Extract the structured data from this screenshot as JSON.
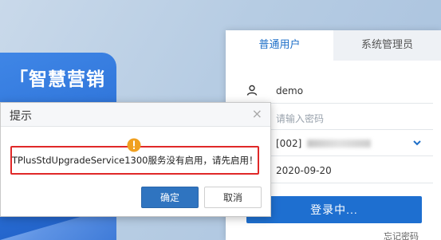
{
  "promo": {
    "title": "「智慧营销"
  },
  "login": {
    "tabs": [
      {
        "label": "普通用户",
        "active": true
      },
      {
        "label": "系统管理员",
        "active": false
      }
    ],
    "username": "demo",
    "password_placeholder": "请输入密码",
    "account_prefix": "[002]",
    "date": "2020-09-20",
    "login_button": "登录中...",
    "forgot_password": "忘记密码"
  },
  "modal": {
    "title": "提示",
    "close_symbol": "×",
    "message": "TPlusStdUpgradeService1300服务没有启用，请先启用！",
    "ok_label": "确定",
    "cancel_label": "取消"
  },
  "colors": {
    "accent": "#1e6fd0",
    "error_border": "#e02828",
    "warning": "#f0a020"
  }
}
